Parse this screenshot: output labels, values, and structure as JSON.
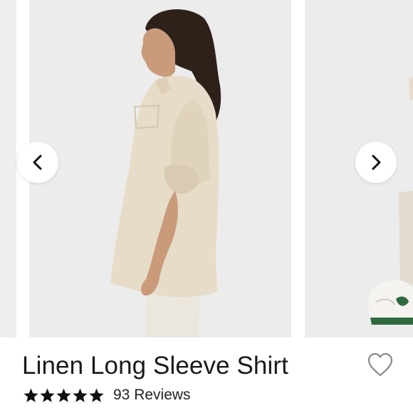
{
  "product": {
    "title": "Linen Long Sleeve Shirt",
    "reviews_text": "93 Reviews",
    "rating": 5,
    "rating_max": 5
  },
  "carousel": {
    "prev_icon": "chevron-left-icon",
    "next_icon": "chevron-right-icon"
  },
  "icons": {
    "favorite": "heart-outline-icon",
    "star": "star-icon"
  },
  "colors": {
    "text": "#1a1a1a",
    "star": "#111111",
    "photo_bg": "#ececec",
    "shirt": "#e6dcc8",
    "sneaker_accent": "#2e6a3e"
  }
}
